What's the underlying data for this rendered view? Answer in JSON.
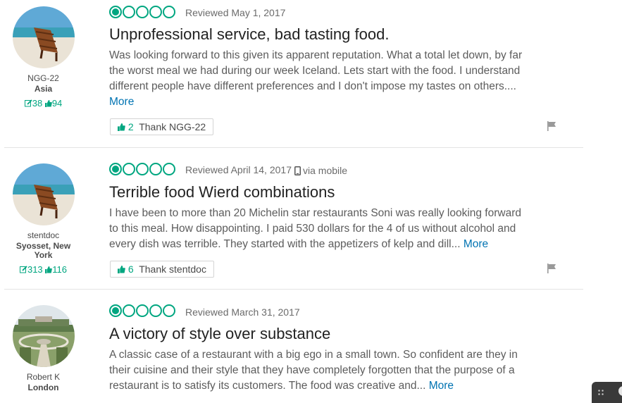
{
  "reviews": [
    {
      "user": {
        "name": "NGG-22",
        "location": "Asia",
        "reviews_count": "38",
        "helpful_count": "94",
        "avatar": "beach-chair-photo"
      },
      "rating": 1,
      "date": "Reviewed May 1, 2017",
      "via": "",
      "title": "Unprofessional service, bad tasting food.",
      "body": "Was looking forward to this given its apparent reputation. What a total let down, by far the worst meal we had during our week Iceland. Lets start with the food. I understand different people have different preferences and I don't impose my tastes on others....",
      "more_label": "More",
      "thank": {
        "count": "2",
        "label": "Thank NGG-22"
      }
    },
    {
      "user": {
        "name": "stentdoc",
        "location": "Syosset, New York",
        "reviews_count": "313",
        "helpful_count": "116",
        "avatar": "beach-chair-photo"
      },
      "rating": 1,
      "date": "Reviewed April 14, 2017",
      "via": "via mobile",
      "title": "Terrible food Wierd combinations",
      "body": "I have been to more than 20 Michelin star restaurants Soni was really looking forward to this meal. How disappointing. I paid 530 dollars for the 4 of us without alcohol and every dish was terrible. They started with the appetizers of kelp and dill...",
      "more_label": "More",
      "thank": {
        "count": "6",
        "label": "Thank stentdoc"
      }
    },
    {
      "user": {
        "name": "Robert K",
        "location": "London",
        "avatar": "garden-photo"
      },
      "rating": 1,
      "date": "Reviewed March 31, 2017",
      "via": "",
      "title": "A victory of style over substance",
      "body": "A classic case of a restaurant with a big ego in a small town. So confident are they in their cuisine and their style that they have completely forgotten that the purpose of a restaurant is to satisfy its customers. The food was creative and...",
      "more_label": "More"
    }
  ],
  "icons": {
    "reviews": "pencil-icon",
    "helpful": "thumbs-up-icon",
    "mobile": "mobile-phone-icon",
    "flag": "flag-icon"
  },
  "colors": {
    "accent": "#00a680",
    "link": "#0073b2",
    "title": "#222222",
    "body": "#5c5c5c"
  }
}
